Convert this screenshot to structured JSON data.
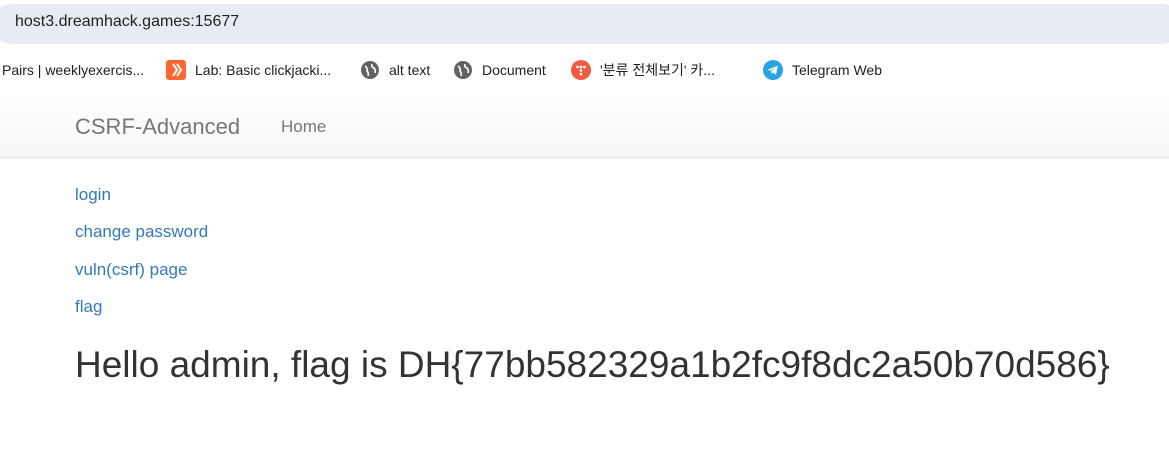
{
  "browser": {
    "url": "host3.dreamhack.games:15677"
  },
  "bookmarks": [
    {
      "label": "Pairs | weeklyexercis...",
      "icon": "none"
    },
    {
      "label": "Lab: Basic clickjacki...",
      "icon": "portswigger-icon"
    },
    {
      "label": "alt text",
      "icon": "globe-icon"
    },
    {
      "label": "Document",
      "icon": "globe-icon"
    },
    {
      "label": "'분류 전체보기' 카...",
      "icon": "tistory-icon"
    },
    {
      "label": "Telegram Web",
      "icon": "telegram-icon"
    }
  ],
  "navbar": {
    "brand": "CSRF-Advanced",
    "home": "Home"
  },
  "links": {
    "login": "login",
    "change_password": "change password",
    "vuln": "vuln(csrf) page",
    "flag": "flag"
  },
  "message": "Hello admin, flag is DH{77bb582329a1b2fc9f8dc2a50b70d586}",
  "colors": {
    "link": "#337ab7",
    "nav_text": "#777777",
    "heading": "#333333"
  }
}
